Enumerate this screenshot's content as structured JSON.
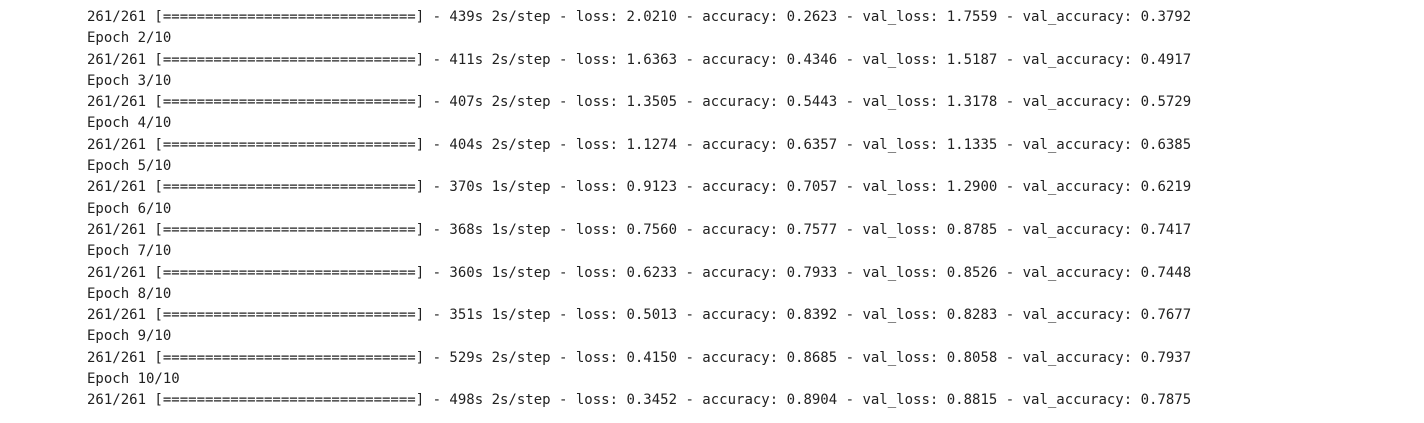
{
  "output": {
    "lines": [
      "261/261 [==============================] - 439s 2s/step - loss: 2.0210 - accuracy: 0.2623 - val_loss: 1.7559 - val_accuracy: 0.3792",
      "Epoch 2/10",
      "261/261 [==============================] - 411s 2s/step - loss: 1.6363 - accuracy: 0.4346 - val_loss: 1.5187 - val_accuracy: 0.4917",
      "Epoch 3/10",
      "261/261 [==============================] - 407s 2s/step - loss: 1.3505 - accuracy: 0.5443 - val_loss: 1.3178 - val_accuracy: 0.5729",
      "Epoch 4/10",
      "261/261 [==============================] - 404s 2s/step - loss: 1.1274 - accuracy: 0.6357 - val_loss: 1.1335 - val_accuracy: 0.6385",
      "Epoch 5/10",
      "261/261 [==============================] - 370s 1s/step - loss: 0.9123 - accuracy: 0.7057 - val_loss: 1.2900 - val_accuracy: 0.6219",
      "Epoch 6/10",
      "261/261 [==============================] - 368s 1s/step - loss: 0.7560 - accuracy: 0.7577 - val_loss: 0.8785 - val_accuracy: 0.7417",
      "Epoch 7/10",
      "261/261 [==============================] - 360s 1s/step - loss: 0.6233 - accuracy: 0.7933 - val_loss: 0.8526 - val_accuracy: 0.7448",
      "Epoch 8/10",
      "261/261 [==============================] - 351s 1s/step - loss: 0.5013 - accuracy: 0.8392 - val_loss: 0.8283 - val_accuracy: 0.7677",
      "Epoch 9/10",
      "261/261 [==============================] - 529s 2s/step - loss: 0.4150 - accuracy: 0.8685 - val_loss: 0.8058 - val_accuracy: 0.7937",
      "Epoch 10/10",
      "261/261 [==============================] - 498s 2s/step - loss: 0.3452 - accuracy: 0.8904 - val_loss: 0.8815 - val_accuracy: 0.7875"
    ]
  }
}
